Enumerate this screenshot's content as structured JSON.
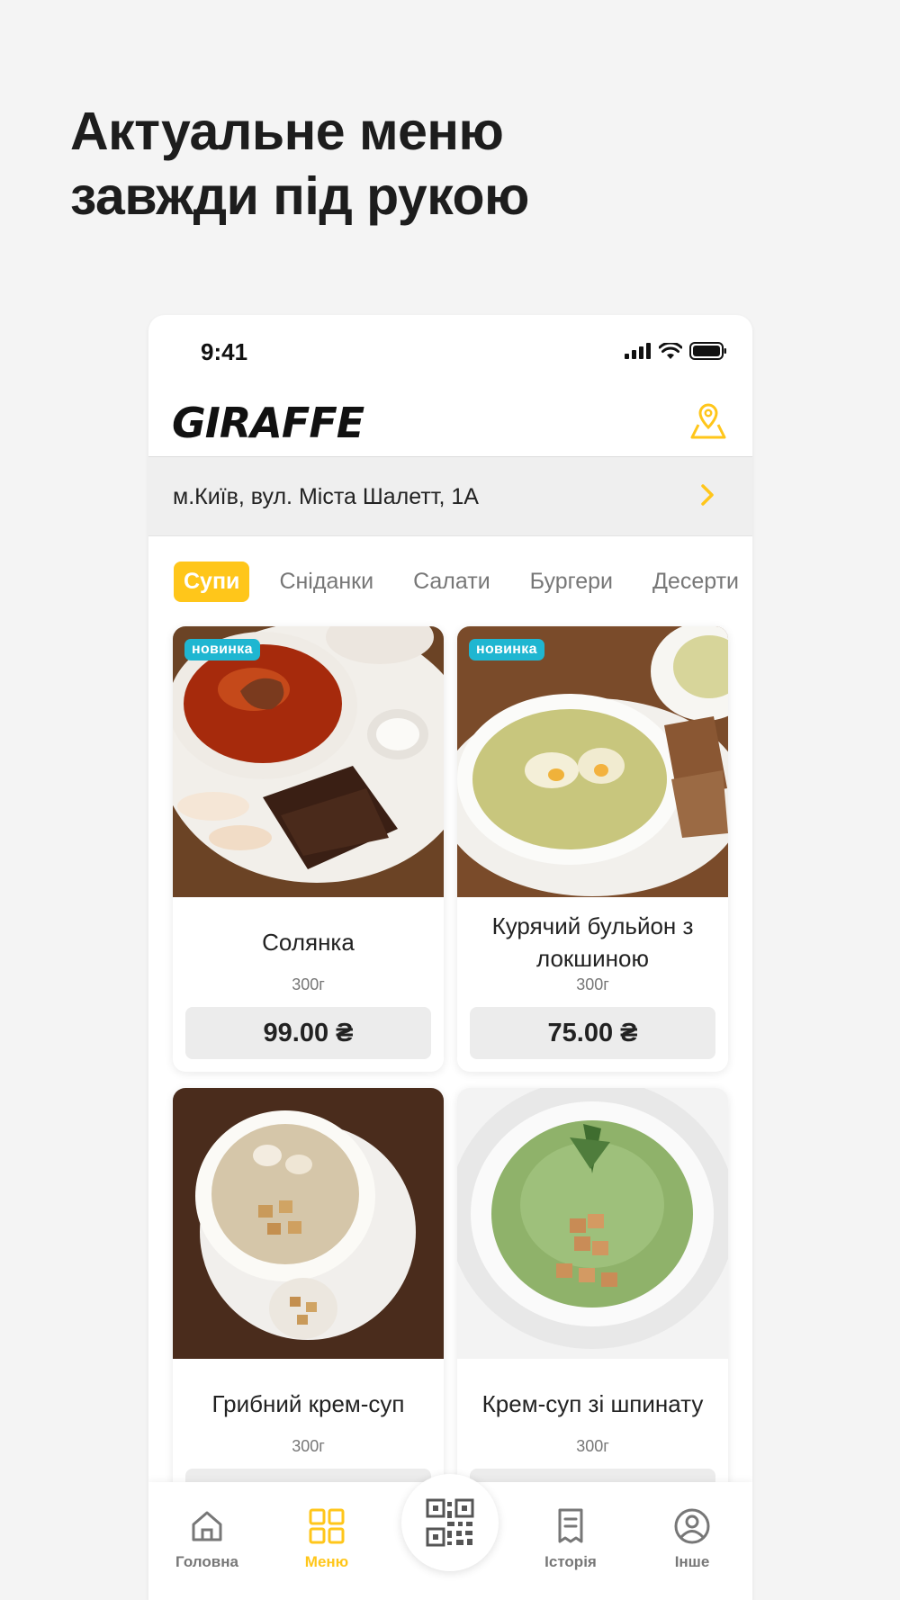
{
  "headline": {
    "line1": "Актуальне меню",
    "line2": "завжди під рукою"
  },
  "status_bar": {
    "time": "9:41"
  },
  "app_bar": {
    "logo_text": "GIRAFFE",
    "accent_color": "#ffc61a"
  },
  "address": {
    "text": "м.Київ, вул. Міста Шалетт, 1А"
  },
  "categories": [
    {
      "label": "Супи",
      "active": true
    },
    {
      "label": "Сніданки",
      "active": false
    },
    {
      "label": "Салати",
      "active": false
    },
    {
      "label": "Бургери",
      "active": false
    },
    {
      "label": "Десерти",
      "active": false
    }
  ],
  "menu_items": [
    {
      "name": "Солянка",
      "weight": "300г",
      "price": "99.00 ₴",
      "badge": "новинка",
      "image": "solyanka-photo"
    },
    {
      "name": "Курячий бульйон з локшиною",
      "weight": "300г",
      "price": "75.00 ₴",
      "badge": "новинка",
      "image": "chicken-broth-photo"
    },
    {
      "name": "Грибний крем-суп",
      "weight": "300г",
      "price": "",
      "badge": "",
      "image": "mushroom-soup-photo"
    },
    {
      "name": "Крем-суп зі шпинату",
      "weight": "300г",
      "price": "",
      "badge": "",
      "image": "spinach-soup-photo"
    }
  ],
  "bottom_nav": {
    "items": [
      {
        "label": "Головна",
        "icon": "home-icon",
        "active": false
      },
      {
        "label": "Меню",
        "icon": "grid-menu-icon",
        "active": true
      },
      {
        "label": "",
        "icon": "qr-code-icon",
        "active": false
      },
      {
        "label": "Історія",
        "icon": "receipt-icon",
        "active": false
      },
      {
        "label": "Інше",
        "icon": "profile-icon",
        "active": false
      }
    ]
  },
  "colors": {
    "accent": "#ffc61a",
    "badge": "#1fb6d1",
    "background": "#f4f4f4"
  }
}
